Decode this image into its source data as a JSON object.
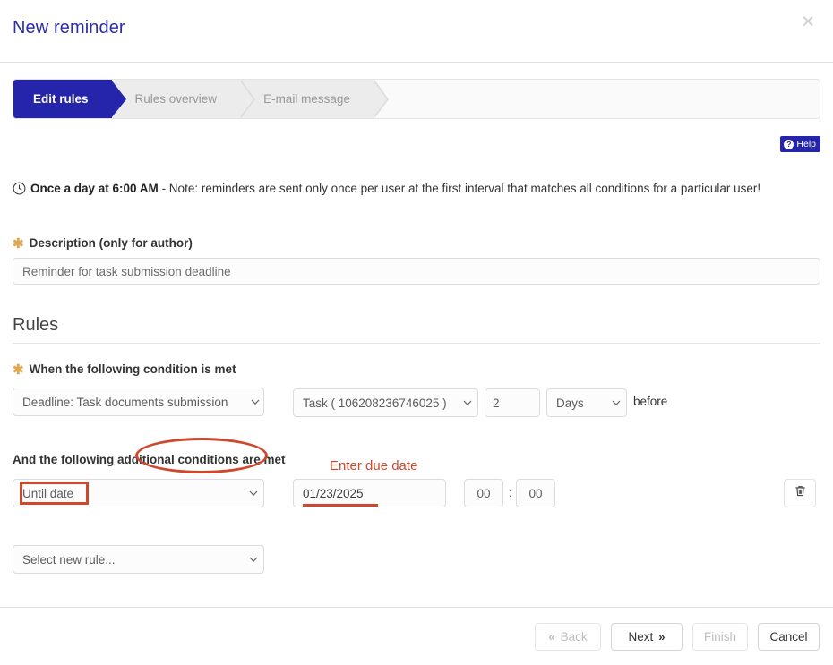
{
  "header": {
    "title": "New reminder",
    "close_icon": "close-icon"
  },
  "wizard": {
    "steps": [
      {
        "label": "Edit rules",
        "state": "active"
      },
      {
        "label": "Rules overview",
        "state": "inactive"
      },
      {
        "label": "E-mail message",
        "state": "inactive"
      }
    ]
  },
  "help": {
    "label": "Help",
    "icon_glyph": "?"
  },
  "notice": {
    "icon": "clock-icon",
    "strong": "Once a day at 6:00 AM",
    "rest": " - Note: reminders are sent only once per user at the first interval that matches all conditions for a particular user!"
  },
  "description": {
    "asterisk": "✱",
    "label": "Description (only for author)",
    "value": "Reminder for task submission deadline",
    "placeholder": "Reminder for task submission deadline"
  },
  "rules": {
    "section_title": "Rules",
    "condition_label": "When the following condition is met",
    "condition_asterisk": "✱",
    "trigger_select": "Deadline: Task documents submission",
    "object_select": "Task ( 106208236746025 )",
    "offset_value": "2",
    "unit_select": "Days",
    "offset_suffix": "before",
    "additional_label": "And the following additional conditions are met",
    "rule_select": "Until date",
    "date_value": "01/23/2025",
    "calendar_icon": "calendar-icon",
    "time_hours": "00",
    "time_separator": ":",
    "time_minutes": "00",
    "delete_icon": "trash-icon",
    "new_rule_select": "Select new rule..."
  },
  "annotations": {
    "color": "#d1472b",
    "callout_text": "Enter due date",
    "ellipse_target": "additional conditions",
    "rect_target": "Until date",
    "underline_target": "01/23/2025"
  },
  "footer": {
    "back": {
      "label": "Back",
      "icon": "«",
      "disabled": true
    },
    "next": {
      "label": "Next",
      "icon": "»",
      "disabled": false
    },
    "finish": {
      "label": "Finish",
      "disabled": true
    },
    "cancel": {
      "label": "Cancel",
      "disabled": false
    }
  }
}
